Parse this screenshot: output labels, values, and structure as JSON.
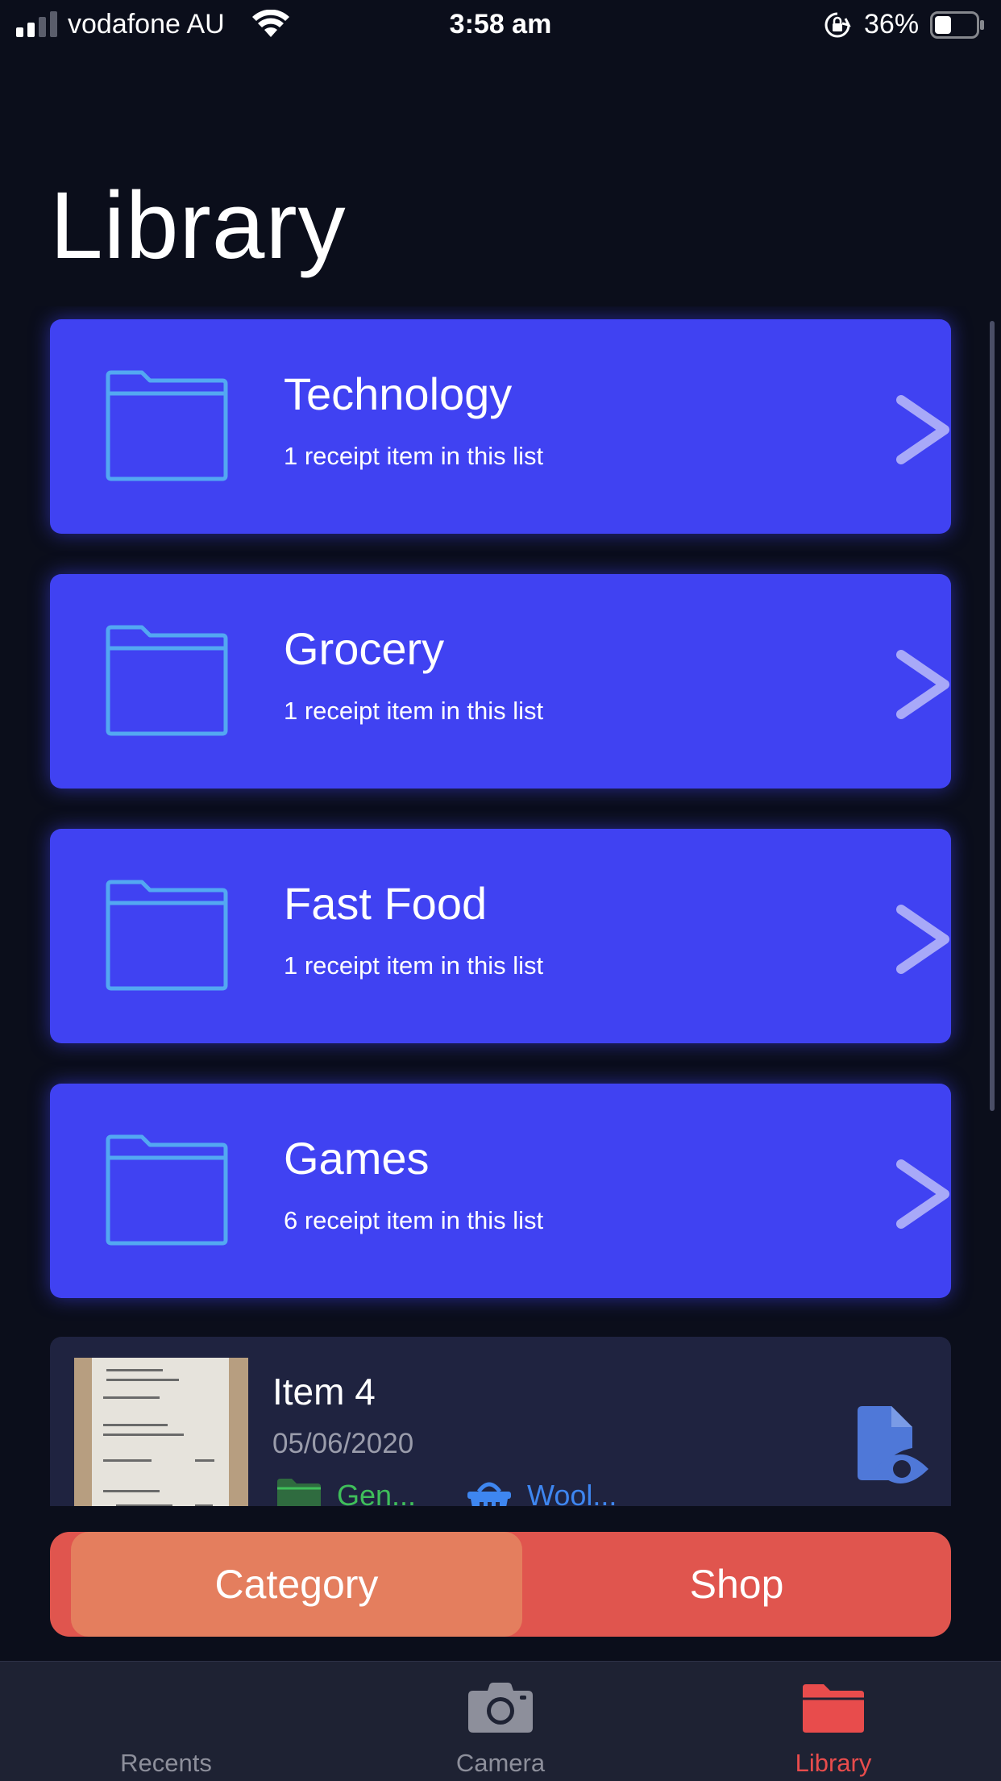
{
  "status_bar": {
    "carrier": "vodafone AU",
    "time": "3:58 am",
    "battery": "36%",
    "signal_bars": 2,
    "battery_level": 0.36
  },
  "page": {
    "title": "Library"
  },
  "folders": [
    {
      "name": "Technology",
      "count_text": "1 receipt item in this list"
    },
    {
      "name": "Grocery",
      "count_text": "1 receipt item in this list"
    },
    {
      "name": "Fast Food",
      "count_text": "1 receipt item in this list"
    },
    {
      "name": "Games",
      "count_text": "6 receipt item in this list"
    }
  ],
  "receipt": {
    "name": "Item 4",
    "date": "05/06/2020",
    "category": "Gen...",
    "shop": "Wool..."
  },
  "segmented": {
    "category_label": "Category",
    "shop_label": "Shop",
    "selected": "Category"
  },
  "tab_bar": {
    "recents": "Recents",
    "camera": "Camera",
    "library": "Library",
    "active": "Library"
  },
  "colors": {
    "background": "#0b0e1b",
    "folder_card": "#4042f2",
    "folder_icon": "#53a8f2",
    "receipt_card": "#1f2340",
    "category_green": "#3fbf5a",
    "shop_blue": "#3e86f0",
    "segment_bg": "#e0554e",
    "segment_selected": "#e47e5e",
    "tab_active": "#e84c4c",
    "tab_inactive": "#8d8f9b"
  },
  "icons": {
    "folder": "folder-outline-icon",
    "chevron": "chevron-right-icon",
    "category": "folder-filled-icon",
    "shop": "basket-icon",
    "view": "document-eye-icon",
    "camera": "camera-icon",
    "library": "folder-filled-icon"
  }
}
